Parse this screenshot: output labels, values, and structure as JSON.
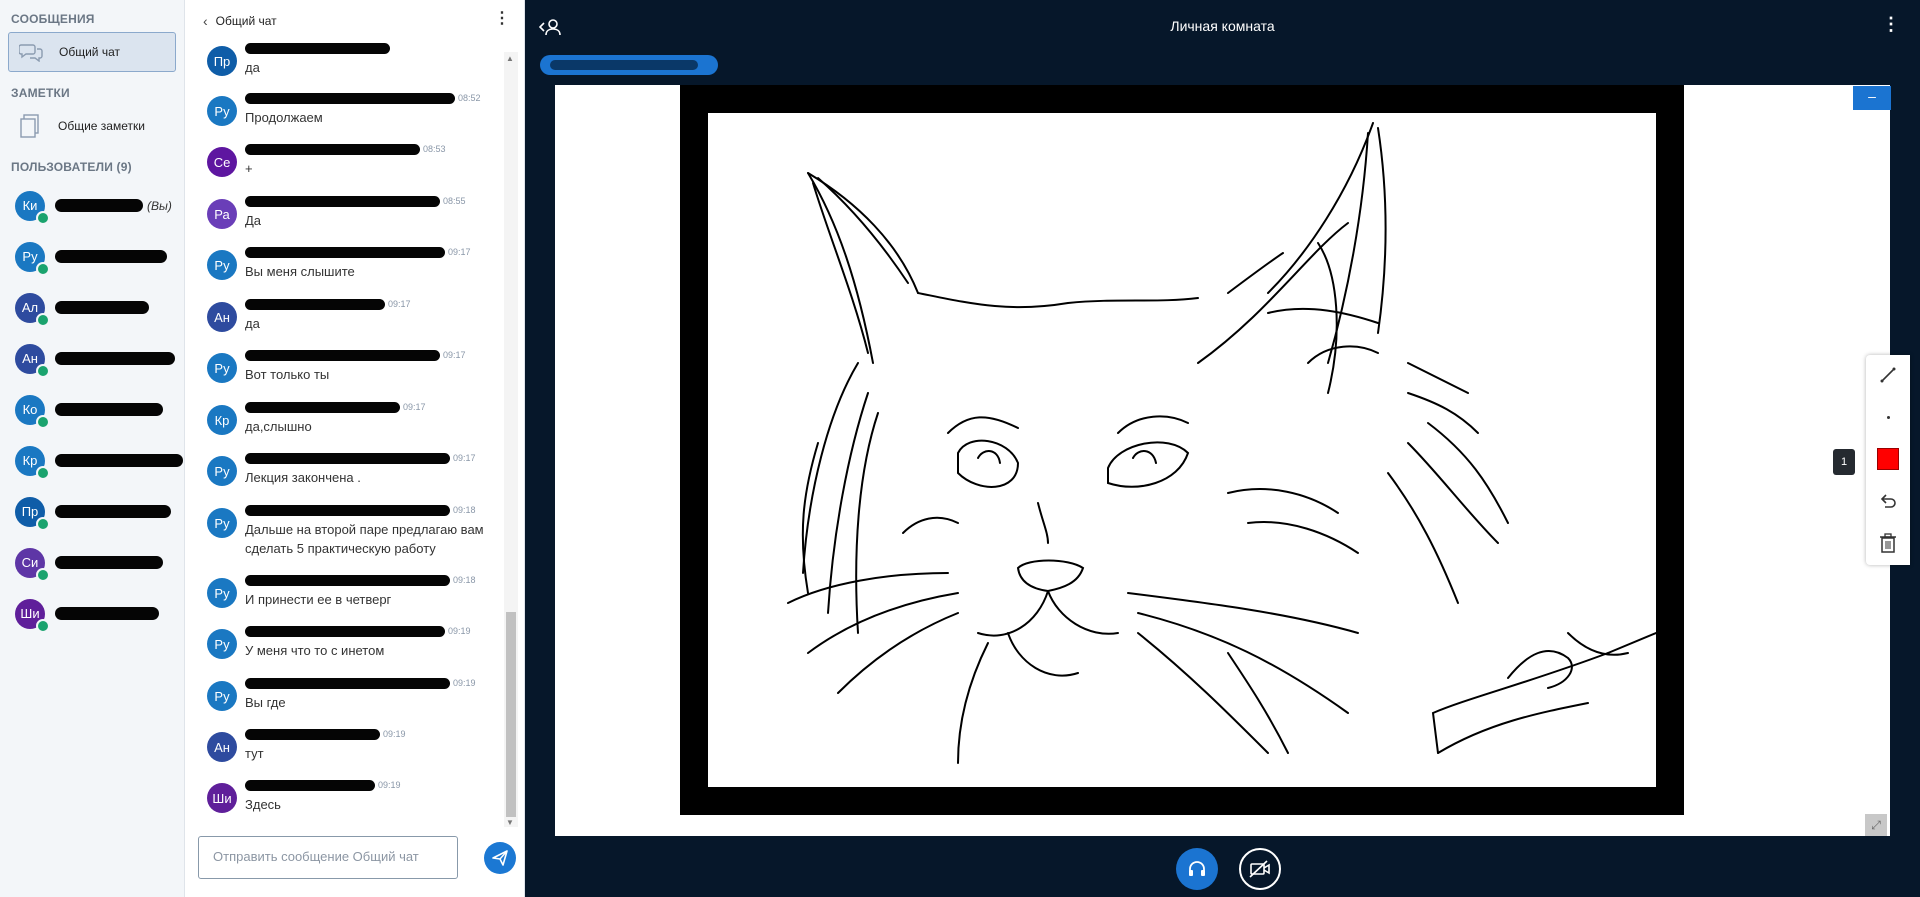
{
  "sidebar": {
    "messages_header": "СООБЩЕНИЯ",
    "public_chat_label": "Общий чат",
    "notes_header": "ЗАМЕТКИ",
    "shared_notes_label": "Общие заметки",
    "users_header": "ПОЛЬЗОВАТЕЛИ (9)",
    "you_label": "(Вы)",
    "users": [
      {
        "initials": "Ки",
        "color": "#1a78c2"
      },
      {
        "initials": "Ру",
        "color": "#1a78c2"
      },
      {
        "initials": "Ал",
        "color": "#2e4b9f"
      },
      {
        "initials": "Ан",
        "color": "#2e4b9f"
      },
      {
        "initials": "Ко",
        "color": "#1a78c2"
      },
      {
        "initials": "Кр",
        "color": "#1a78c2"
      },
      {
        "initials": "Пр",
        "color": "#0f5da8"
      },
      {
        "initials": "Си",
        "color": "#5e36a6"
      },
      {
        "initials": "Ши",
        "color": "#5f1f9a"
      }
    ]
  },
  "chat": {
    "title": "Общий чат",
    "input_placeholder": "Отправить сообщение Общий чат",
    "messages": [
      {
        "initials": "Пр",
        "color": "#0f5da8",
        "time": "",
        "text": "да"
      },
      {
        "initials": "Ру",
        "color": "#1a78c2",
        "time": "08:52",
        "text": "Продолжаем"
      },
      {
        "initials": "Се",
        "color": "#5e16a0",
        "time": "08:53",
        "text": "+"
      },
      {
        "initials": "Ра",
        "color": "#6a3eb8",
        "time": "08:55",
        "text": "Да"
      },
      {
        "initials": "Ру",
        "color": "#1a78c2",
        "time": "09:17",
        "text": "Вы меня слышите"
      },
      {
        "initials": "Ан",
        "color": "#2e4b9f",
        "time": "09:17",
        "text": "да"
      },
      {
        "initials": "Ру",
        "color": "#1a78c2",
        "time": "09:17",
        "text": "Вот только ты"
      },
      {
        "initials": "Кр",
        "color": "#1a78c2",
        "time": "09:17",
        "text": "да,слышно"
      },
      {
        "initials": "Ру",
        "color": "#1a78c2",
        "time": "09:17",
        "text": "Лекция закончена ."
      },
      {
        "initials": "Ру",
        "color": "#1a78c2",
        "time": "09:18",
        "text": "Дальше на второй паре предлагаю вам сделать 5 практическую работу"
      },
      {
        "initials": "Ру",
        "color": "#1a78c2",
        "time": "09:18",
        "text": "И принести ее в четверг"
      },
      {
        "initials": "Ру",
        "color": "#1a78c2",
        "time": "09:19",
        "text": "У меня что то с инетом"
      },
      {
        "initials": "Ру",
        "color": "#1a78c2",
        "time": "09:19",
        "text": "Вы где"
      },
      {
        "initials": "Ан",
        "color": "#2e4b9f",
        "time": "09:19",
        "text": "тут"
      },
      {
        "initials": "Ши",
        "color": "#5f1f9a",
        "time": "09:19",
        "text": "Здесь"
      }
    ]
  },
  "main": {
    "room_title": "Личная комната",
    "page_number": "1",
    "minimize_label": "–"
  },
  "colors": {
    "accent": "#1b74d1",
    "background": "#06172a",
    "active_color_swatch": "#ff0000"
  }
}
